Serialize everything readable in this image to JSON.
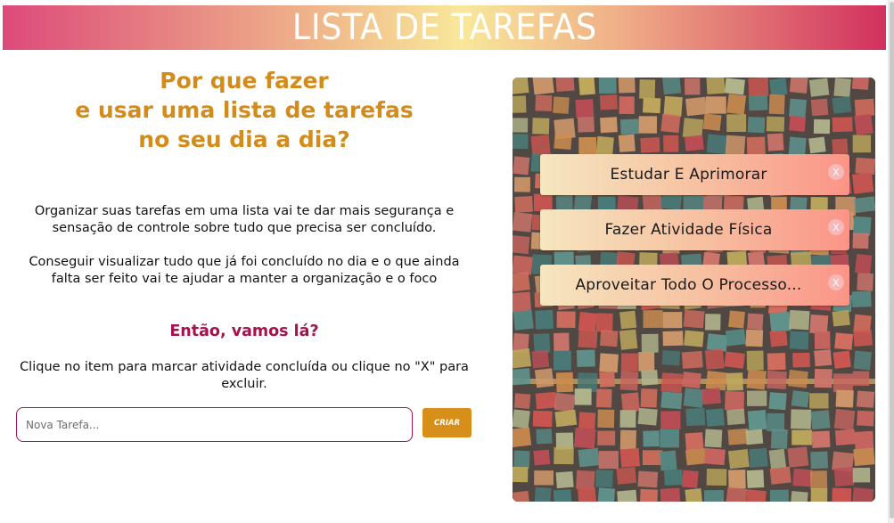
{
  "header": {
    "title": "LISTA DE TAREFAS"
  },
  "intro": {
    "question_lines": [
      "Por que fazer",
      "e usar uma lista de tarefas",
      "no seu dia a dia?"
    ],
    "paragraph_1": "Organizar suas tarefas em uma lista vai te dar mais segurança e sensação de controle sobre tudo que precisa ser concluído.",
    "paragraph_2": "Conseguir visualizar tudo que já foi concluído no dia e o que ainda falta ser feito vai te ajudar a manter a organização e o foco",
    "cta": "Então, vamos lá?",
    "instructions": "Clique no item para marcar atividade concluída ou clique no \"X\" para excluir."
  },
  "form": {
    "input_placeholder": "Nova Tarefa...",
    "input_value": "",
    "create_label": "CRIAR"
  },
  "tasks": [
    {
      "label": "Estudar E Aprimorar",
      "close": "X"
    },
    {
      "label": "Fazer Atividade Física",
      "close": "X"
    },
    {
      "label": "Aproveitar Todo O Processo...",
      "close": "X"
    }
  ],
  "colors": {
    "accent_orange": "#d38c1c",
    "accent_magenta": "#a5124e",
    "button_orange": "#d88f1a"
  }
}
